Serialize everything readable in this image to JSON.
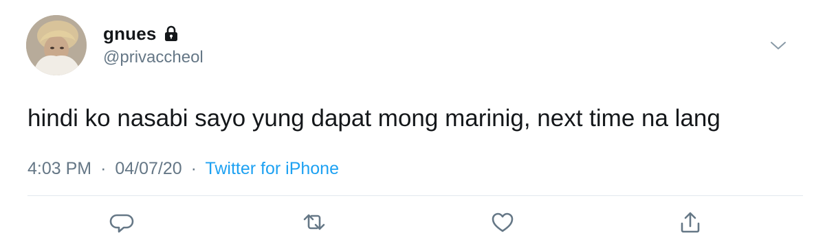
{
  "tweet": {
    "display_name": "gnues",
    "handle": "@privaccheol",
    "text": "hindi ko nasabi sayo yung dapat mong marinig, next time na lang",
    "time": "4:03 PM",
    "date": "04/07/20",
    "separator": "·",
    "source": "Twitter for iPhone"
  },
  "icons": {
    "lock": "lock-icon",
    "caret": "chevron-down-icon",
    "reply": "reply-icon",
    "retweet": "retweet-icon",
    "like": "heart-icon",
    "share": "share-icon"
  },
  "colors": {
    "text": "#14171a",
    "secondary": "#657786",
    "link": "#1da1f2",
    "divider": "#e1e8ed"
  }
}
